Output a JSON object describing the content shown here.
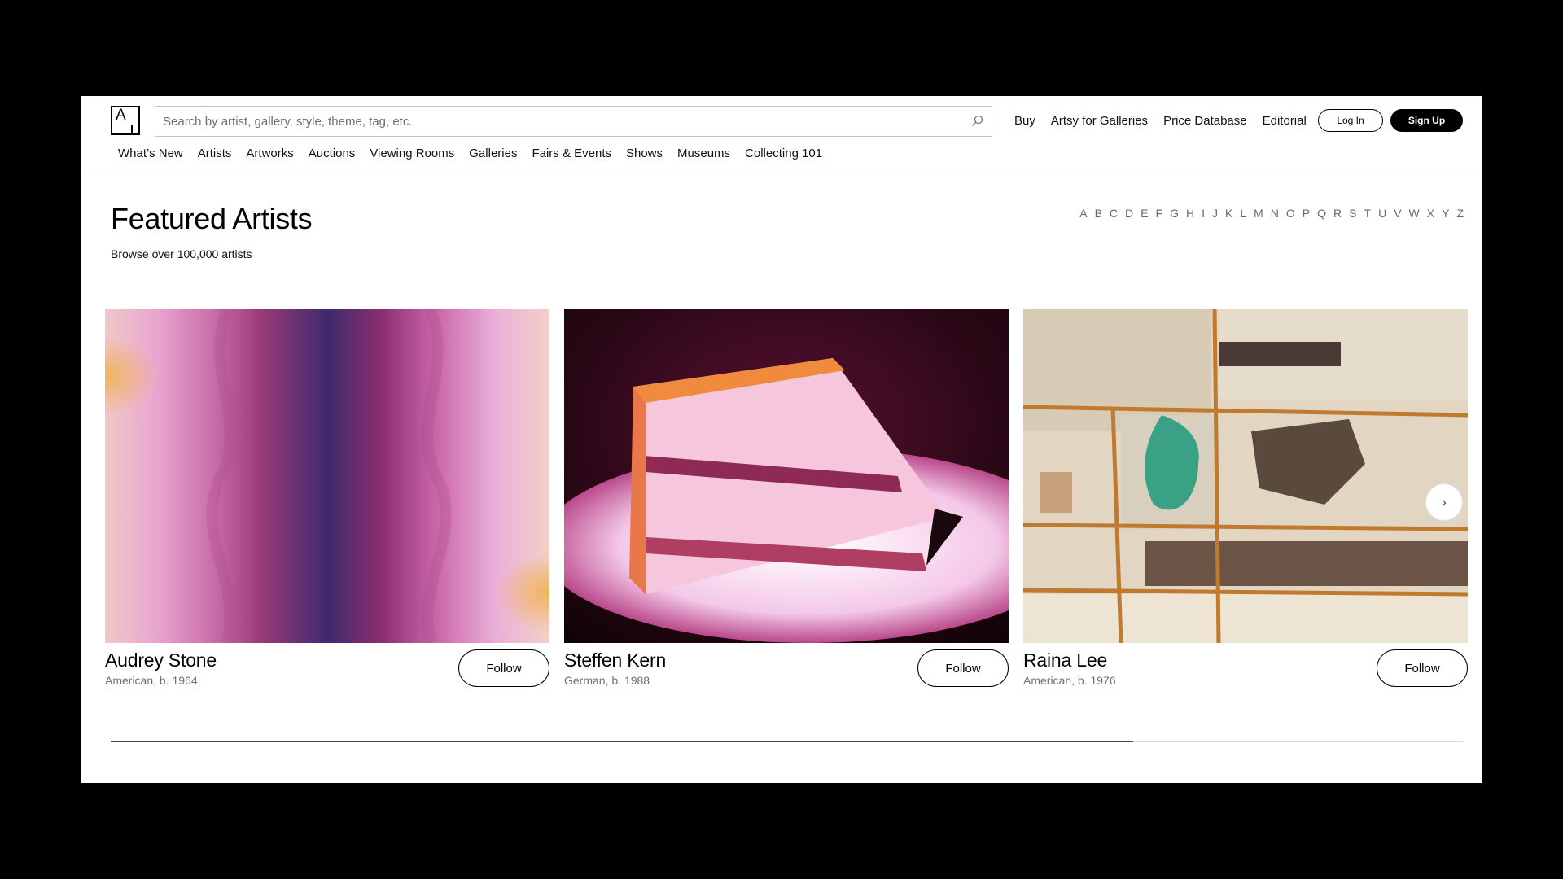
{
  "header": {
    "search_placeholder": "Search by artist, gallery, style, theme, tag, etc.",
    "top_links": [
      "Buy",
      "Artsy for Galleries",
      "Price Database",
      "Editorial"
    ],
    "login_label": "Log In",
    "signup_label": "Sign Up",
    "nav": [
      "What’s New",
      "Artists",
      "Artworks",
      "Auctions",
      "Viewing Rooms",
      "Galleries",
      "Fairs & Events",
      "Shows",
      "Museums",
      "Collecting 101"
    ]
  },
  "featured": {
    "title": "Featured Artists",
    "subtitle": "Browse over 100,000 artists",
    "alphabet": [
      "A",
      "B",
      "C",
      "D",
      "E",
      "F",
      "G",
      "H",
      "I",
      "J",
      "K",
      "L",
      "M",
      "N",
      "O",
      "P",
      "Q",
      "R",
      "S",
      "T",
      "U",
      "V",
      "W",
      "X",
      "Y",
      "Z"
    ],
    "cards": [
      {
        "name": "Audrey Stone",
        "meta": "American, b. 1964",
        "follow_label": "Follow"
      },
      {
        "name": "Steffen Kern",
        "meta": "German, b. 1988",
        "follow_label": "Follow"
      },
      {
        "name": "Raina Lee",
        "meta": "American, b. 1976",
        "follow_label": "Follow"
      }
    ],
    "carousel_progress": 0.756
  },
  "icons": {
    "search": "search-icon",
    "next": "chevron-right-icon",
    "logo": "artsy-logo"
  }
}
